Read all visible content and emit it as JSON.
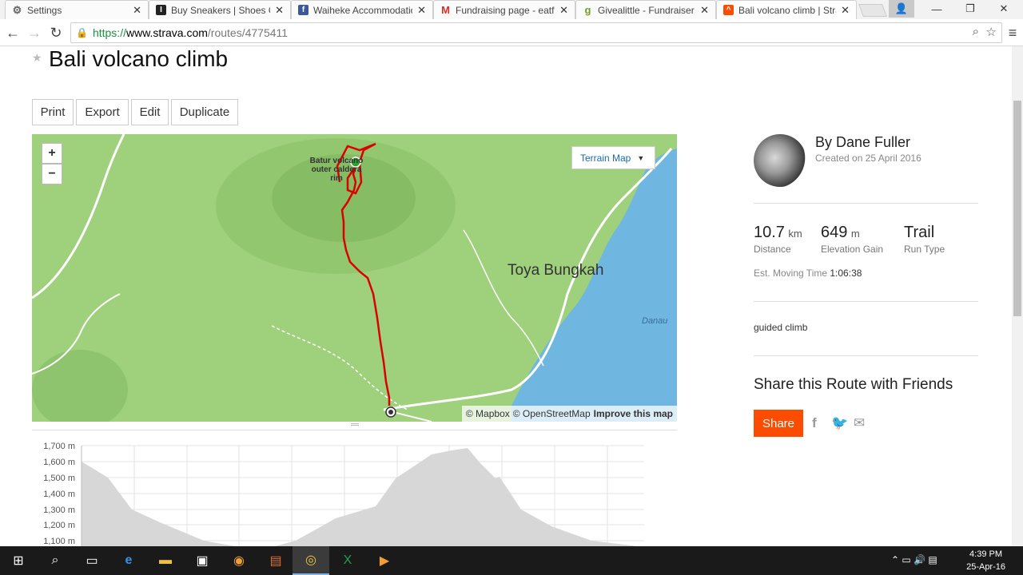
{
  "browser": {
    "tabs": [
      {
        "title": "Settings",
        "icon": "gear-icon",
        "color": "#666666"
      },
      {
        "title": "Buy Sneakers | Shoes Onl",
        "icon": "sneakers-site-icon",
        "color": "#222222"
      },
      {
        "title": "Waiheke Accommodation",
        "icon": "facebook-icon",
        "color": "#3b5998"
      },
      {
        "title": "Fundraising page - eatfit",
        "icon": "gmail-icon",
        "color": "#d93025"
      },
      {
        "title": "Givealittle - Fundraiser -",
        "icon": "givealittle-icon",
        "color": "#7a9a2e"
      },
      {
        "title": "Bali volcano climb | Strav",
        "icon": "strava-icon",
        "color": "#fc4c02"
      }
    ],
    "url_scheme": "https://",
    "url_domain": "www.strava.com",
    "url_path": "/routes/4775411"
  },
  "route": {
    "title": "Bali volcano climb",
    "actions": [
      "Print",
      "Export",
      "Edit",
      "Duplicate"
    ]
  },
  "map": {
    "zoom_in": "+",
    "zoom_out": "−",
    "layer_selector": "Terrain Map",
    "place_label": "Toya Bungkah",
    "lake_label": "Danau",
    "summit_label": "Batur volcano outer caldera rim",
    "attribution_mapbox": "© Mapbox",
    "attribution_osm": "© OpenStreetMap",
    "improve_link": "Improve this map"
  },
  "elevation": {
    "y_labels": [
      "1,700 m",
      "1,600 m",
      "1,500 m",
      "1,400 m",
      "1,300 m",
      "1,200 m",
      "1,100 m"
    ]
  },
  "athlete": {
    "byline": "By Dane Fuller",
    "created": "Created on 25 April 2016"
  },
  "stats": [
    {
      "value": "10.7",
      "unit": "km",
      "label": "Distance"
    },
    {
      "value": "649",
      "unit": "m",
      "label": "Elevation Gain"
    },
    {
      "value": "Trail",
      "unit": "",
      "label": "Run Type"
    }
  ],
  "moving_time": {
    "label": "Est. Moving Time",
    "value": "1:06:38"
  },
  "description": "guided climb",
  "share": {
    "heading": "Share this Route with Friends",
    "button": "Share"
  },
  "taskbar": {
    "time": "4:39 PM",
    "date": "25-Apr-16"
  }
}
